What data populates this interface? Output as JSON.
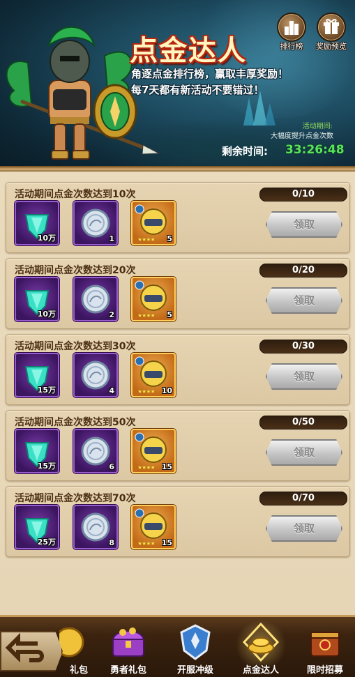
{
  "banner": {
    "title": "点金达人",
    "line1": "角逐点金排行榜，赢取丰厚奖励！",
    "line2": "每7天都有新活动不要错过！",
    "period_label": "活动期间:",
    "period_desc": "大幅度提升点金次数",
    "remain_label": "剩余时间:",
    "remain_time": "33:26:48",
    "btn_rank": "排行榜",
    "btn_reward": "奖励预览"
  },
  "tasks": [
    {
      "title": "活动期间点金次数达到10次",
      "progress": "0/10",
      "claim": "领取",
      "items": [
        {
          "type": "gem",
          "qty": "10万"
        },
        {
          "type": "coin",
          "qty": "1"
        },
        {
          "type": "hero",
          "qty": "5"
        }
      ]
    },
    {
      "title": "活动期间点金次数达到20次",
      "progress": "0/20",
      "claim": "领取",
      "items": [
        {
          "type": "gem",
          "qty": "10万"
        },
        {
          "type": "coin",
          "qty": "2"
        },
        {
          "type": "hero",
          "qty": "5"
        }
      ]
    },
    {
      "title": "活动期间点金次数达到30次",
      "progress": "0/30",
      "claim": "领取",
      "items": [
        {
          "type": "gem",
          "qty": "15万"
        },
        {
          "type": "coin",
          "qty": "4"
        },
        {
          "type": "hero",
          "qty": "10"
        }
      ]
    },
    {
      "title": "活动期间点金次数达到50次",
      "progress": "0/50",
      "claim": "领取",
      "items": [
        {
          "type": "gem",
          "qty": "15万"
        },
        {
          "type": "coin",
          "qty": "6"
        },
        {
          "type": "hero",
          "qty": "15"
        }
      ]
    },
    {
      "title": "活动期间点金次数达到70次",
      "progress": "0/70",
      "claim": "领取",
      "items": [
        {
          "type": "gem",
          "qty": "25万"
        },
        {
          "type": "coin",
          "qty": "8"
        },
        {
          "type": "hero",
          "qty": "15"
        }
      ]
    }
  ],
  "hero_stars": "★★★★",
  "nav": {
    "items": [
      {
        "label": "礼包",
        "icon": "gift-coin-icon"
      },
      {
        "label": "勇者礼包",
        "icon": "treasure-chest-icon"
      },
      {
        "label": "开服冲级",
        "icon": "level-up-shield-icon"
      },
      {
        "label": "点金达人",
        "icon": "gold-pile-icon",
        "selected": true
      },
      {
        "label": "限时招募",
        "icon": "recruit-chest-icon"
      }
    ]
  },
  "colors": {
    "title_stroke": "#b4250e",
    "timer_green": "#59e35a",
    "period_green": "#8fd45b",
    "card_bg": "#dcc8a3",
    "purple_frame": "#9a5ccc",
    "orange_frame": "#ffcf5e"
  }
}
